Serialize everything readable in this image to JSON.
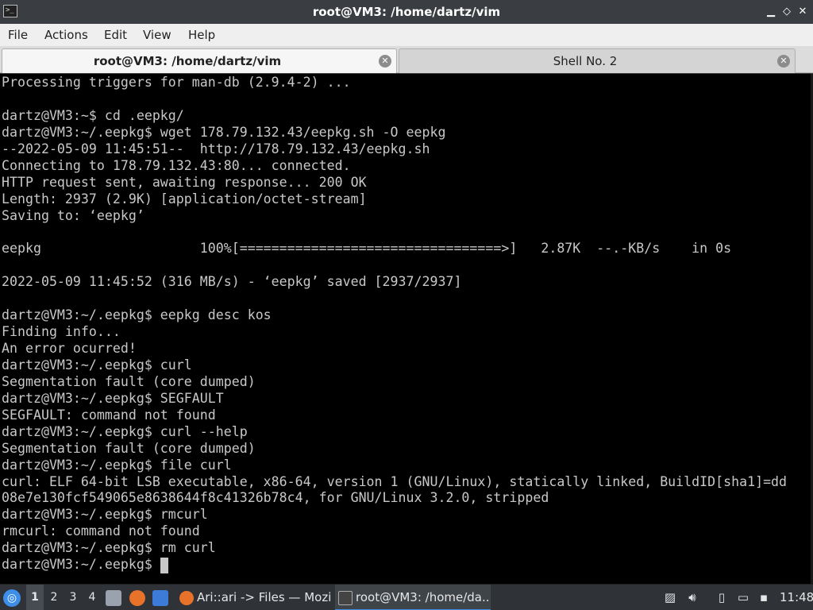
{
  "window": {
    "title": "root@VM3: /home/dartz/vim",
    "controls": {
      "minimize": "▁",
      "restore": "◇",
      "close": "✕"
    }
  },
  "menu": [
    "File",
    "Actions",
    "Edit",
    "View",
    "Help"
  ],
  "tabs": [
    {
      "label": "root@VM3: /home/dartz/vim",
      "active": true
    },
    {
      "label": "Shell No. 2",
      "active": false
    }
  ],
  "terminal": {
    "lines": [
      "Processing triggers for man-db (2.9.4-2) ...",
      "",
      "dartz@VM3:~$ cd .eepkg/",
      "dartz@VM3:~/.eepkg$ wget 178.79.132.43/eepkg.sh -O eepkg",
      "--2022-05-09 11:45:51--  http://178.79.132.43/eepkg.sh",
      "Connecting to 178.79.132.43:80... connected.",
      "HTTP request sent, awaiting response... 200 OK",
      "Length: 2937 (2.9K) [application/octet-stream]",
      "Saving to: ‘eepkg’",
      "",
      "eepkg                    100%[=================================>]   2.87K  --.-KB/s    in 0s",
      "",
      "2022-05-09 11:45:52 (316 MB/s) - ‘eepkg’ saved [2937/2937]",
      "",
      "dartz@VM3:~/.eepkg$ eepkg desc kos",
      "Finding info...",
      "An error ocurred!",
      "dartz@VM3:~/.eepkg$ curl",
      "Segmentation fault (core dumped)",
      "dartz@VM3:~/.eepkg$ SEGFAULT",
      "SEGFAULT: command not found",
      "dartz@VM3:~/.eepkg$ curl --help",
      "Segmentation fault (core dumped)",
      "dartz@VM3:~/.eepkg$ file curl",
      "curl: ELF 64-bit LSB executable, x86-64, version 1 (GNU/Linux), statically linked, BuildID[sha1]=dd",
      "08e7e130fcf549065e8638644f8c41326b78c4, for GNU/Linux 3.2.0, stripped",
      "dartz@VM3:~/.eepkg$ rmcurl",
      "rmcurl: command not found",
      "dartz@VM3:~/.eepkg$ rm curl",
      "dartz@VM3:~/.eepkg$ "
    ]
  },
  "taskbar": {
    "workspaces": [
      "1",
      "2",
      "3",
      "4"
    ],
    "tasks": [
      {
        "label": "Ari::ari -> Files — Mozi...",
        "icon": "firefox-icon"
      },
      {
        "label": "root@VM3: /home/da...",
        "icon": "terminal-icon"
      }
    ],
    "clock": "11:48"
  },
  "colors": {
    "terminal_bg": "#000000",
    "terminal_fg": "#c8c8c8",
    "accent": "#3d8ee8"
  }
}
